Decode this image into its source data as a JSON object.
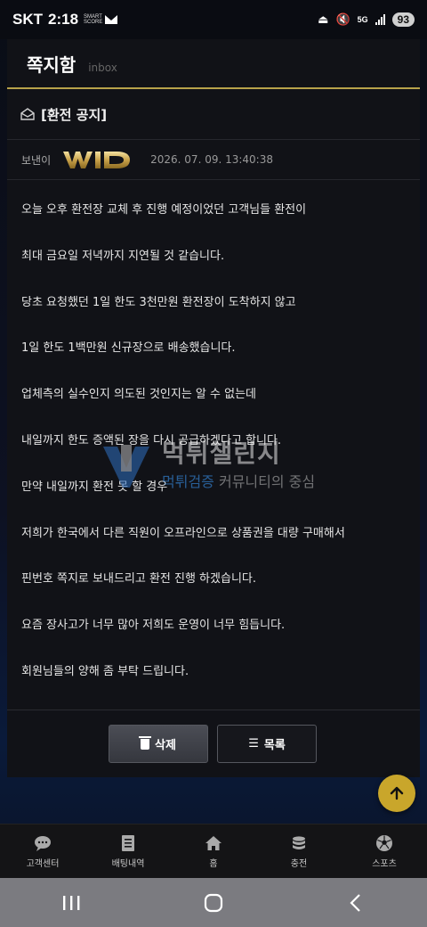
{
  "status_bar": {
    "carrier": "SKT",
    "time": "2:18",
    "smart_score": "SMART SCORE",
    "network": "5G",
    "battery": "93"
  },
  "header": {
    "title": "쪽지함",
    "subtitle": "inbox"
  },
  "message": {
    "subject": "[환전 공지]",
    "sender_label": "보낸이",
    "sender_logo_text": "WID",
    "date": "2026. 07. 09. 13:40:38",
    "lines": [
      "오늘 오후 환전장 교체 후 진행 예정이었던 고객님들 환전이",
      "최대 금요일 저녁까지 지연될 것 같습니다.",
      "당초 요청했던 1일 한도 3천만원 환전장이 도착하지 않고",
      "1일 한도 1백만원 신규장으로 배송했습니다.",
      "업체측의 실수인지 의도된 것인지는 알 수 없는데",
      "내일까지 한도 증액된 장을 다시 공급하겠다고 합니다.",
      "만약 내일까지 환전 못 할 경우",
      "저희가 한국에서 다른 직원이 오프라인으로 상품권을 대량 구매해서",
      "핀번호 쪽지로 보내드리고 환전 진행 하겠습니다.",
      "요즘 장사고가 너무 많아 저희도 운영이 너무 힘듭니다.",
      "회원님들의 양해 좀 부탁 드립니다."
    ]
  },
  "actions": {
    "delete_label": "삭제",
    "list_label": "목록"
  },
  "watermark": {
    "title": "먹튀챌린지",
    "sub_highlight": "먹튀검증",
    "sub_rest": " 커뮤니티의 중심"
  },
  "bottom_nav": [
    {
      "label": "고객센터",
      "icon": "chat-icon"
    },
    {
      "label": "배팅내역",
      "icon": "document-icon"
    },
    {
      "label": "홈",
      "icon": "home-icon"
    },
    {
      "label": "충전",
      "icon": "coins-icon"
    },
    {
      "label": "스포츠",
      "icon": "soccer-ball-icon"
    }
  ],
  "colors": {
    "accent_gold": "#b8a24a",
    "fab_gold": "#c9a62b",
    "card_bg": "#111217"
  }
}
